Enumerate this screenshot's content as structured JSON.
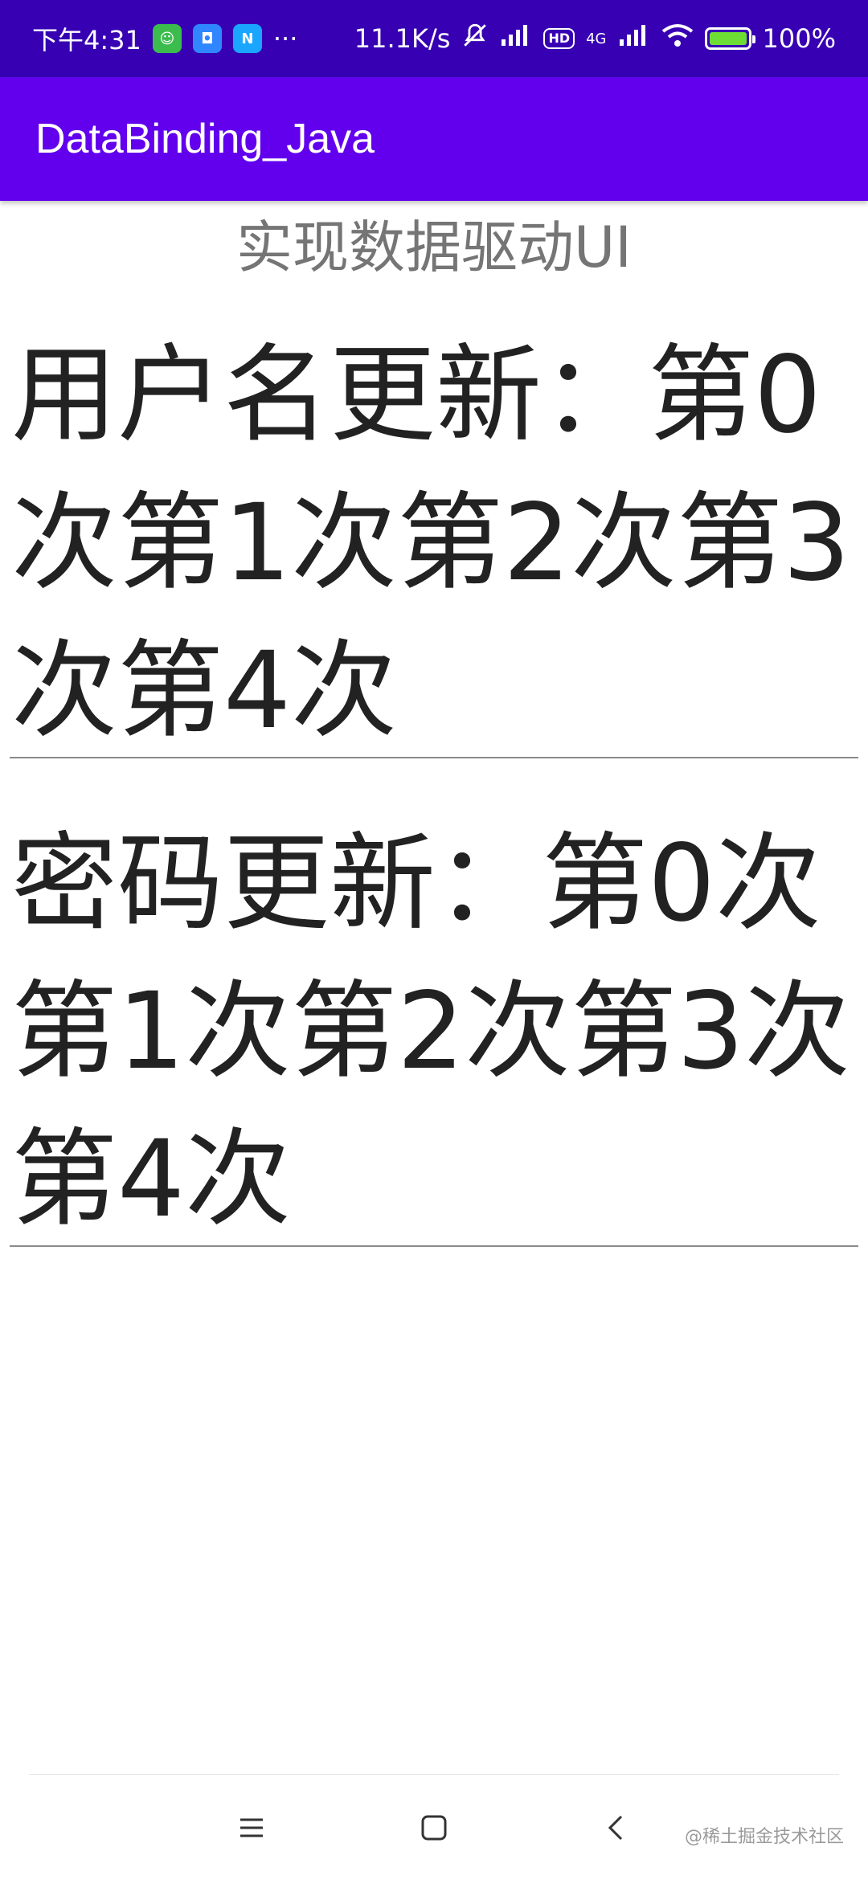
{
  "status_bar": {
    "time": "下午4:31",
    "notification_icons": [
      "wechat-icon",
      "app-icon",
      "n-icon"
    ],
    "more": "···",
    "net_speed": "11.1K/s",
    "hd_badge": "HD",
    "network_type": "4G",
    "battery_level": "100%",
    "colors": {
      "background": "#3700b3"
    }
  },
  "app_bar": {
    "title": "DataBinding_Java",
    "colors": {
      "background": "#6200ee"
    }
  },
  "content": {
    "subtitle": "实现数据驱动UI",
    "username_text": "用户名更新：第0次第1次第2次第3次第4次",
    "password_text": "密码更新：第0次第1次第2次第3次第4次"
  },
  "nav_bar": {
    "icons": [
      "menu-icon",
      "home-icon",
      "back-icon"
    ]
  },
  "watermark": "@稀土掘金技术社区"
}
